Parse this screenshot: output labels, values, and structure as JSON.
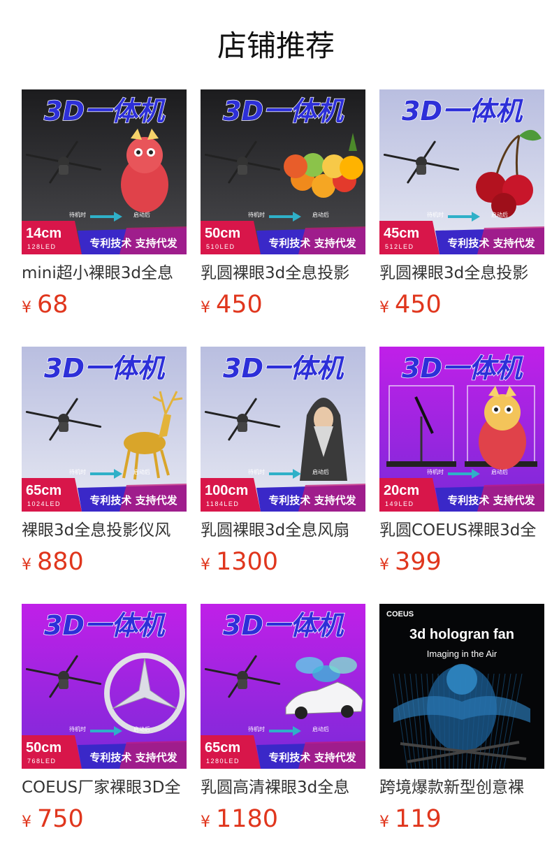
{
  "page": {
    "title": "店铺推荐"
  },
  "badge": {
    "banner": "3D一体机",
    "patent": "专利技术 支持代发",
    "standby": "待机时",
    "started": "启动后"
  },
  "products": [
    {
      "name": "mini超小裸眼3d全息",
      "currency": "¥",
      "price": "68",
      "size": "14cm",
      "led": "128LED",
      "theme": "dark",
      "subject": "dragon-figure"
    },
    {
      "name": "乳圆裸眼3d全息投影",
      "currency": "¥",
      "price": "450",
      "size": "50cm",
      "led": "510LED",
      "theme": "dark",
      "subject": "fruit"
    },
    {
      "name": "乳圆裸眼3d全息投影",
      "currency": "¥",
      "price": "450",
      "size": "45cm",
      "led": "512LED",
      "theme": "light",
      "subject": "cherries"
    },
    {
      "name": "裸眼3d全息投影仪风",
      "currency": "¥",
      "price": "880",
      "size": "65cm",
      "led": "1024LED",
      "theme": "light",
      "subject": "golden-deer"
    },
    {
      "name": "乳圆裸眼3d全息风扇",
      "currency": "¥",
      "price": "1300",
      "size": "100cm",
      "led": "1184LED",
      "theme": "light",
      "subject": "wizard"
    },
    {
      "name": "乳圆COEUS裸眼3d全",
      "currency": "¥",
      "price": "399",
      "size": "20cm",
      "led": "149LED",
      "theme": "purple",
      "subject": "dragon-figure"
    },
    {
      "name": "COEUS厂家裸眼3D全",
      "currency": "¥",
      "price": "750",
      "size": "50cm",
      "led": "768LED",
      "theme": "purple",
      "subject": "star-logo"
    },
    {
      "name": "乳圆高清裸眼3d全息",
      "currency": "¥",
      "price": "1180",
      "size": "65cm",
      "led": "1280LED",
      "theme": "purple",
      "subject": "sports-car"
    },
    {
      "name": "跨境爆款新型创意裸",
      "currency": "¥",
      "price": "119",
      "brand": "COEUS",
      "headline": "3d hologran fan",
      "tagline": "Imaging in the Air",
      "theme": "black",
      "subject": "hologram-person"
    }
  ],
  "colors": {
    "price": "#e0361d",
    "dark_bg": "#2a2a2a",
    "light_bg": "#c8cce0",
    "purple_bg": "#b31ee0",
    "badge_red": "#d8164a",
    "badge_blue": "#3a28c8",
    "arrow": "#2fb0c8"
  }
}
